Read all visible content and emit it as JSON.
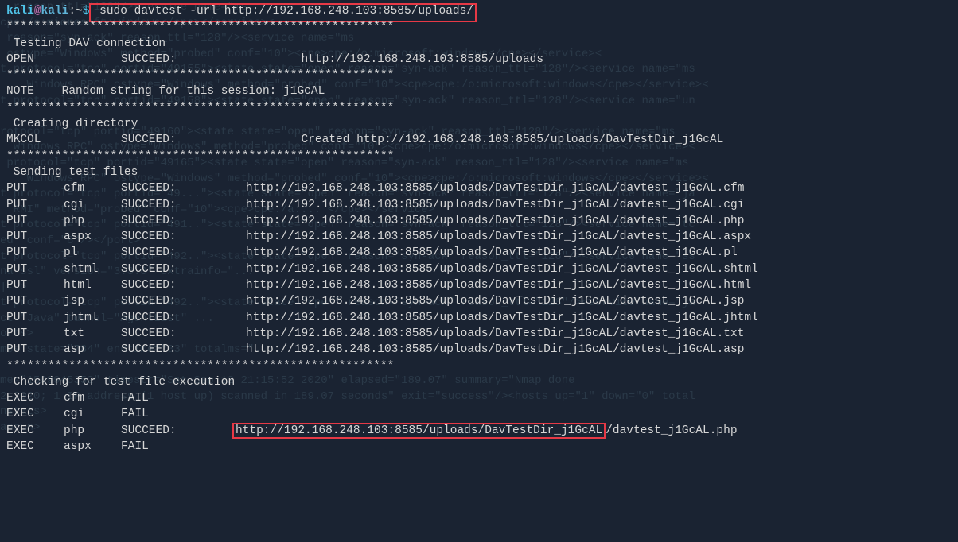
{
  "prompt": {
    "user": "kali",
    "at": "@",
    "host": "kali",
    "sep": ":",
    "path": "~",
    "dollar": "$",
    "command": " sudo davtest -url http://192.168.248.103:8585/uploads/"
  },
  "stars": "********************************************************",
  "section_test_conn": " Testing DAV connection",
  "open_line": {
    "c1": "OPEN",
    "c2": "",
    "c3": "SUCCEED:",
    "rest": "               http://192.168.248.103:8585/uploads"
  },
  "note_line": "NOTE    Random string for this session: j1GcAL",
  "section_create_dir": " Creating directory",
  "mkcol_line": {
    "c1": "MKCOL",
    "c2": "",
    "c3": "SUCCEED:",
    "rest": "               Created http://192.168.248.103:8585/uploads/DavTestDir_j1GcAL"
  },
  "section_send": " Sending test files",
  "put_lines": [
    {
      "c1": "PUT",
      "c2": "cfm",
      "c3": "SUCCEED:",
      "rest": "       http://192.168.248.103:8585/uploads/DavTestDir_j1GcAL/davtest_j1GcAL.cfm"
    },
    {
      "c1": "PUT",
      "c2": "cgi",
      "c3": "SUCCEED:",
      "rest": "       http://192.168.248.103:8585/uploads/DavTestDir_j1GcAL/davtest_j1GcAL.cgi"
    },
    {
      "c1": "PUT",
      "c2": "php",
      "c3": "SUCCEED:",
      "rest": "       http://192.168.248.103:8585/uploads/DavTestDir_j1GcAL/davtest_j1GcAL.php"
    },
    {
      "c1": "PUT",
      "c2": "aspx",
      "c3": "SUCCEED:",
      "rest": "       http://192.168.248.103:8585/uploads/DavTestDir_j1GcAL/davtest_j1GcAL.aspx"
    },
    {
      "c1": "PUT",
      "c2": "pl",
      "c3": "SUCCEED:",
      "rest": "       http://192.168.248.103:8585/uploads/DavTestDir_j1GcAL/davtest_j1GcAL.pl"
    },
    {
      "c1": "PUT",
      "c2": "shtml",
      "c3": "SUCCEED:",
      "rest": "       http://192.168.248.103:8585/uploads/DavTestDir_j1GcAL/davtest_j1GcAL.shtml"
    },
    {
      "c1": "PUT",
      "c2": "html",
      "c3": "SUCCEED:",
      "rest": "       http://192.168.248.103:8585/uploads/DavTestDir_j1GcAL/davtest_j1GcAL.html"
    },
    {
      "c1": "PUT",
      "c2": "jsp",
      "c3": "SUCCEED:",
      "rest": "       http://192.168.248.103:8585/uploads/DavTestDir_j1GcAL/davtest_j1GcAL.jsp"
    },
    {
      "c1": "PUT",
      "c2": "jhtml",
      "c3": "SUCCEED:",
      "rest": "       http://192.168.248.103:8585/uploads/DavTestDir_j1GcAL/davtest_j1GcAL.jhtml"
    },
    {
      "c1": "PUT",
      "c2": "txt",
      "c3": "SUCCEED:",
      "rest": "       http://192.168.248.103:8585/uploads/DavTestDir_j1GcAL/davtest_j1GcAL.txt"
    },
    {
      "c1": "PUT",
      "c2": "asp",
      "c3": "SUCCEED:",
      "rest": "       http://192.168.248.103:8585/uploads/DavTestDir_j1GcAL/davtest_j1GcAL.asp"
    }
  ],
  "section_check": " Checking for test file execution",
  "exec_lines": [
    {
      "c1": "EXEC",
      "c2": "cfm",
      "c3": "FAIL",
      "rest": ""
    },
    {
      "c1": "EXEC",
      "c2": "cgi",
      "c3": "FAIL",
      "rest": ""
    }
  ],
  "exec_php": {
    "c1": "EXEC",
    "c2": "php",
    "c3": "SUCCEED:",
    "url1": "http://192.168.248.103:8585/uploads/DavTestDir_j1GcAL",
    "url2": "/davtest_j1GcAL.php"
  },
  "exec_aspx": {
    "c1": "EXEC",
    "c2": "aspx",
    "c3": "FAIL",
    "rest": ""
  },
  "bg_text": "  reason ttl=\"128\"/><service name=\"ms\ncpe:/o:microsoft:windows</cpe></service><\n reason=\"syn-ack\" reason_ttl=\"128\"/><service name=\"ms\n ostype=\"Windows\" method=\"probed\" conf=\"10\"><cpe>cpe:/o:microsoft:windows</cpe></service><\nt protocol=\"tcp\" portid=\"49155\"><state state=\"open\" reason=\"syn-ack\" reason_ttl=\"128\"/><service name=\"ms\n    Windows RPC\" ostype=\"Windows\" method=\"probed\" conf=\"10\"><cpe>cpe:/o:microsoft:windows</cpe></service><\nt protocol=\"tcp\" portid=\"49158\"><state state=\"open\" reason=\"syn-ack\" reason_ttl=\"128\"/><service name=\"un\n\nrotocol=\"tcp\" portid=\"49160\"><state state=\"open\" reason=\"syn-ack\" reason_ttl=\"128\"/><service name=\"ms\n  Windows RPC\" ostype=\"Windows\" method=\"probed\" conf=\"10\"><cpe>cpe:/o:microsoft:windows</cpe></service><\n protocol=\"tcp\" portid=\"49165\"><state state=\"open\" reason=\"syn-ack\" reason_ttl=\"128\"/><service name=\"ms\n    Windows RPC\" ostype=\"Windows\" method=\"probed\" conf=\"10\"><cpe>cpe:/o:microsoft:windows</cpe></service><\nt protocol=\"tcp\" portid=\"49...\"><state state=\"open\" reason=\"syn-ack\" reason_ttl=\"128\"/><service name=\"ja\n  RMI\" method=\"probed\" conf=\"10\"><cpe>cpe:/a:... </cpe></service>\nt protocol=\"tcp\" portid=\"491..\"><state state=\"open\" reason=\"syn-ack\" reason_ttl=\"128\"/><service name=\"tc\ned\" conf=\"8\"/></port>\nt protocol=\"tcp\" portid=\"492..\"><state state=\"open\" reason=\"syn-ack\" reason_ttl=\"128\"/><service name=\"ss\nna ssl\" version=\"3.3.0\" extrainfo=\"... \n|-->\nt protocol=\"tcp\" portid=\"492..\"><state state=\"open\" reason=\"syn-ack\" reason_ttl=\"128\"/><service name=\"ja\nct=\"Java\" tunnel=\"AgentList\" ...\norts>\nmes state=\"784\" endtime=\"83\" totalms=\"...\n\nme=\"1599945352\" timestr=\"Sat Sep 12 21:15:52 2020\" elapsed=\"189.07\" summary=\"Nmap done\n2 2020; 1 IP address (1 host up) scanned in 189.07 seconds\" exit=\"success\"/><hosts up=\"1\" down=\"0\" total\nnstats>\naprun>"
}
